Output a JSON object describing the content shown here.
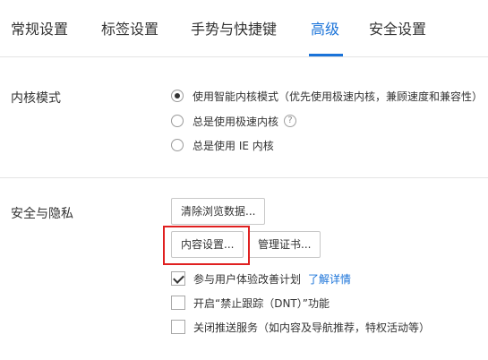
{
  "tabs": [
    {
      "label": "常规设置",
      "active": false
    },
    {
      "label": "标签设置",
      "active": false
    },
    {
      "label": "手势与快捷键",
      "active": false
    },
    {
      "label": "高级",
      "active": true
    },
    {
      "label": "安全设置",
      "active": false
    }
  ],
  "kernel": {
    "title": "内核模式",
    "options": [
      {
        "label": "使用智能内核模式（优先使用极速内核，兼顾速度和兼容性）",
        "checked": true
      },
      {
        "label": "总是使用极速内核",
        "checked": false,
        "help": "?"
      },
      {
        "label": "总是使用 IE 内核",
        "checked": false
      }
    ]
  },
  "security": {
    "title": "安全与隐私",
    "buttons": {
      "clear_data": "清除浏览数据...",
      "content_settings": "内容设置...",
      "manage_certs": "管理证书..."
    },
    "checkboxes": [
      {
        "label": "参与用户体验改善计划",
        "checked": true,
        "link": "了解详情"
      },
      {
        "label": "开启“禁止跟踪（DNT）”功能",
        "checked": false
      },
      {
        "label": "关闭推送服务（如内容及导航推荐，特权活动等）",
        "checked": false
      }
    ]
  },
  "colors": {
    "accent": "#1a73d9",
    "highlight": "#e02020"
  }
}
